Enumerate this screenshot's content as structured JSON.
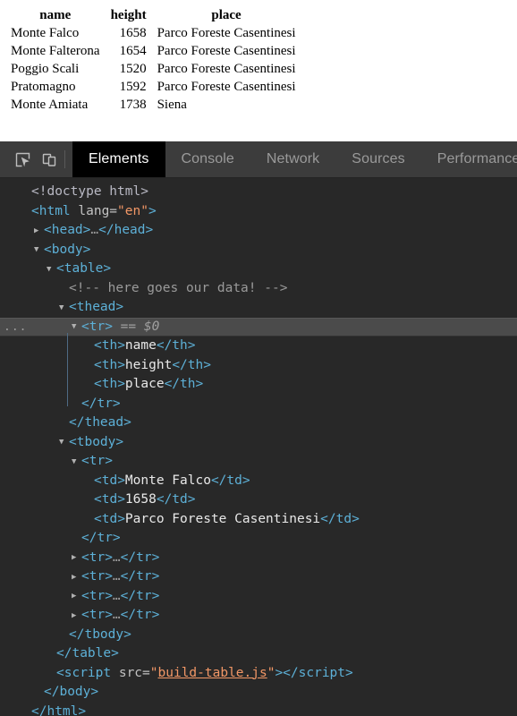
{
  "page": {
    "table": {
      "headers": [
        "name",
        "height",
        "place"
      ],
      "rows": [
        [
          "Monte Falco",
          "1658",
          "Parco Foreste Casentinesi"
        ],
        [
          "Monte Falterona",
          "1654",
          "Parco Foreste Casentinesi"
        ],
        [
          "Poggio Scali",
          "1520",
          "Parco Foreste Casentinesi"
        ],
        [
          "Pratomagno",
          "1592",
          "Parco Foreste Casentinesi"
        ],
        [
          "Monte Amiata",
          "1738",
          "Siena"
        ]
      ]
    }
  },
  "devtools": {
    "toolbar": {
      "icons": [
        {
          "name": "inspect-element-icon",
          "title": "Inspect element"
        },
        {
          "name": "device-toolbar-icon",
          "title": "Toggle device toolbar"
        }
      ],
      "tabs": [
        {
          "label": "Elements",
          "active": true
        },
        {
          "label": "Console",
          "active": false
        },
        {
          "label": "Network",
          "active": false
        },
        {
          "label": "Sources",
          "active": false
        },
        {
          "label": "Performance",
          "active": false
        }
      ]
    },
    "dom_tree": {
      "selected_node_reference": "== $0",
      "gutter_marker": "...",
      "lines": [
        {
          "indent": 0,
          "twisty": "none",
          "type": "doctype",
          "text": "<!doctype html>"
        },
        {
          "indent": 0,
          "twisty": "none",
          "type": "open-attr",
          "tag": "html",
          "attr_name": "lang",
          "attr_value": "\"en\""
        },
        {
          "indent": 1,
          "twisty": "closed",
          "type": "collapsed",
          "tag": "head"
        },
        {
          "indent": 1,
          "twisty": "open",
          "type": "open",
          "tag": "body"
        },
        {
          "indent": 2,
          "twisty": "open",
          "type": "open",
          "tag": "table"
        },
        {
          "indent": 3,
          "twisty": "none",
          "type": "comment",
          "text": "<!-- here goes our data! -->"
        },
        {
          "indent": 3,
          "twisty": "open",
          "type": "open",
          "tag": "thead"
        },
        {
          "indent": 4,
          "twisty": "open",
          "type": "open",
          "tag": "tr",
          "selected": true
        },
        {
          "indent": 5,
          "twisty": "none",
          "type": "leaf",
          "tag": "th",
          "text": "name"
        },
        {
          "indent": 5,
          "twisty": "none",
          "type": "leaf",
          "tag": "th",
          "text": "height"
        },
        {
          "indent": 5,
          "twisty": "none",
          "type": "leaf",
          "tag": "th",
          "text": "place"
        },
        {
          "indent": 4,
          "twisty": "none",
          "type": "close",
          "tag": "tr"
        },
        {
          "indent": 3,
          "twisty": "none",
          "type": "close",
          "tag": "thead"
        },
        {
          "indent": 3,
          "twisty": "open",
          "type": "open",
          "tag": "tbody"
        },
        {
          "indent": 4,
          "twisty": "open",
          "type": "open",
          "tag": "tr"
        },
        {
          "indent": 5,
          "twisty": "none",
          "type": "leaf",
          "tag": "td",
          "text": "Monte Falco"
        },
        {
          "indent": 5,
          "twisty": "none",
          "type": "leaf",
          "tag": "td",
          "text": "1658"
        },
        {
          "indent": 5,
          "twisty": "none",
          "type": "leaf",
          "tag": "td",
          "text": "Parco Foreste Casentinesi"
        },
        {
          "indent": 4,
          "twisty": "none",
          "type": "close",
          "tag": "tr"
        },
        {
          "indent": 4,
          "twisty": "closed",
          "type": "collapsed",
          "tag": "tr"
        },
        {
          "indent": 4,
          "twisty": "closed",
          "type": "collapsed",
          "tag": "tr"
        },
        {
          "indent": 4,
          "twisty": "closed",
          "type": "collapsed",
          "tag": "tr"
        },
        {
          "indent": 4,
          "twisty": "closed",
          "type": "collapsed",
          "tag": "tr"
        },
        {
          "indent": 3,
          "twisty": "none",
          "type": "close",
          "tag": "tbody"
        },
        {
          "indent": 2,
          "twisty": "none",
          "type": "close",
          "tag": "table"
        },
        {
          "indent": 2,
          "twisty": "none",
          "type": "script",
          "tag": "script",
          "attr_name": "src",
          "attr_value": "build-table.js"
        },
        {
          "indent": 1,
          "twisty": "none",
          "type": "close",
          "tag": "body"
        },
        {
          "indent": 0,
          "twisty": "none",
          "type": "close",
          "tag": "html"
        }
      ]
    }
  },
  "colors": {
    "panel_background": "#282828",
    "toolbar_background": "#3c3c3c",
    "active_tab_background": "#000000",
    "selected_row_background": "#4b4b4b",
    "tag_color": "#5db0d7",
    "attribute_value_color": "#f29766",
    "text_node_color": "#e8e8e8",
    "comment_color": "#9a9a9a"
  }
}
